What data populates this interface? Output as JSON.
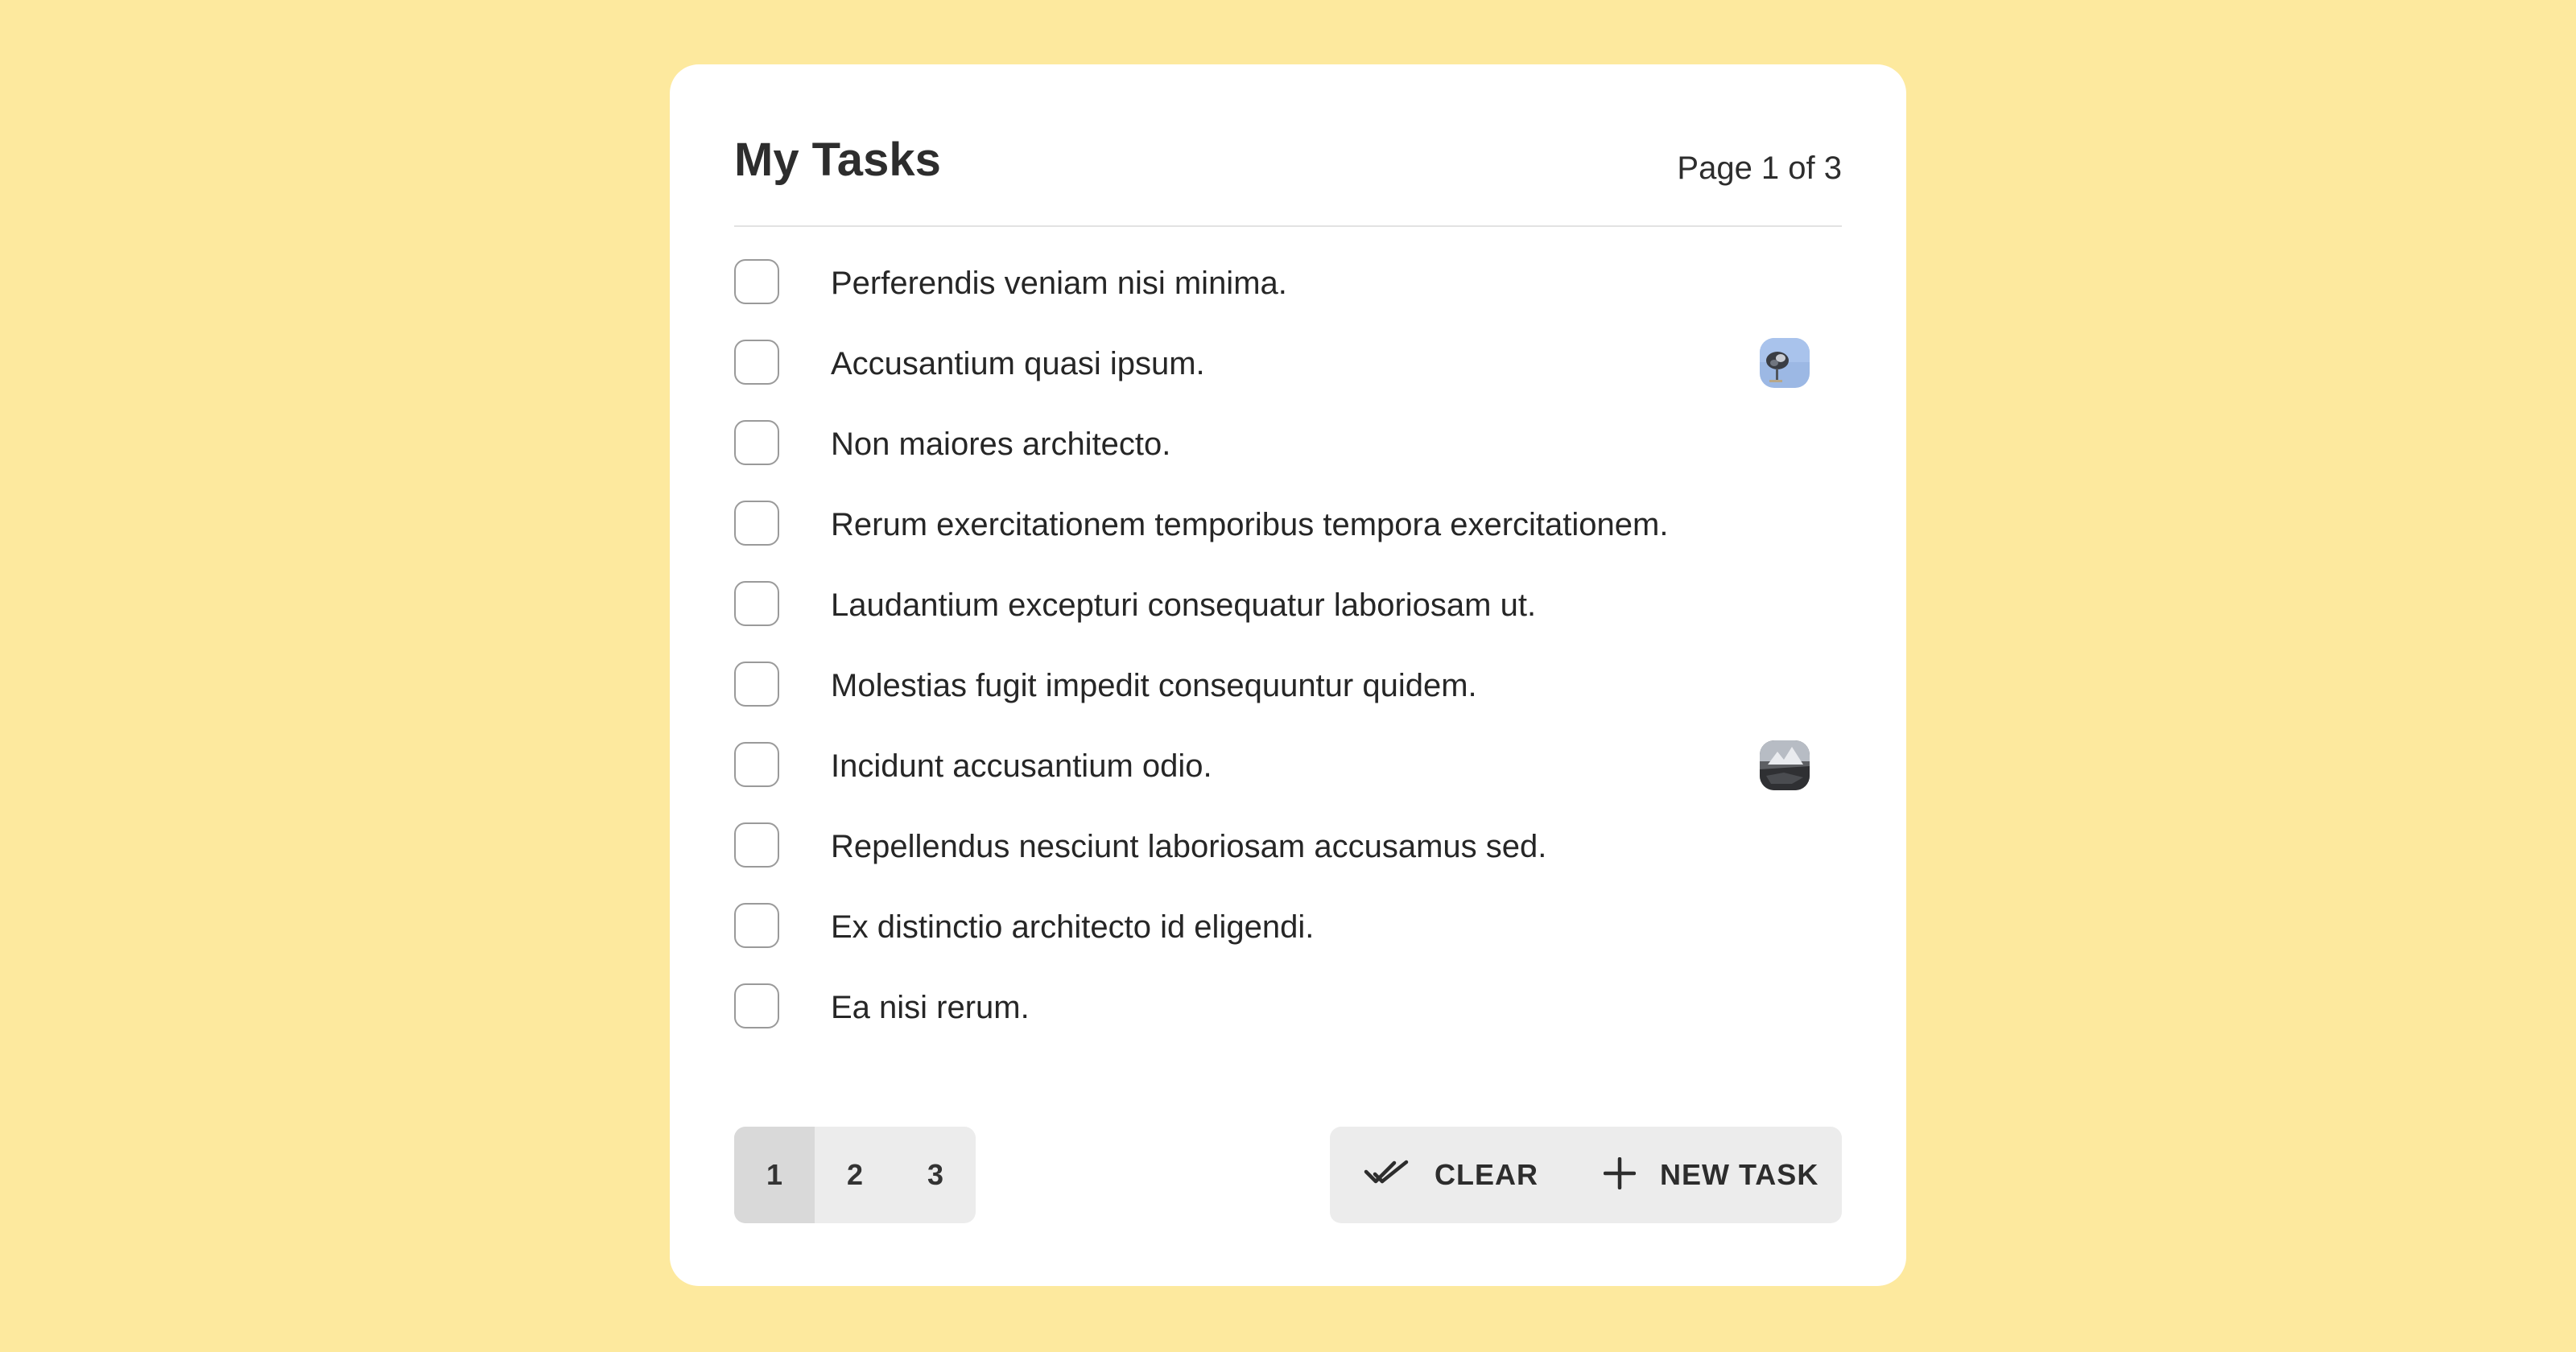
{
  "header": {
    "title": "My Tasks",
    "page_indicator": "Page 1 of 3"
  },
  "tasks": [
    {
      "text": "Perferendis veniam nisi minima.",
      "checked": false,
      "attachment": null
    },
    {
      "text": "Accusantium quasi ipsum.",
      "checked": false,
      "attachment": "photo-thumbnail"
    },
    {
      "text": "Non maiores architecto.",
      "checked": false,
      "attachment": null
    },
    {
      "text": "Rerum exercitationem temporibus tempora exercitationem.",
      "checked": false,
      "attachment": null
    },
    {
      "text": "Laudantium excepturi consequatur laboriosam ut.",
      "checked": false,
      "attachment": null
    },
    {
      "text": "Molestias fugit impedit consequuntur quidem.",
      "checked": false,
      "attachment": null
    },
    {
      "text": "Incidunt accusantium odio.",
      "checked": false,
      "attachment": "photo-thumbnail"
    },
    {
      "text": "Repellendus nesciunt laboriosam accusamus sed.",
      "checked": false,
      "attachment": null
    },
    {
      "text": "Ex distinctio architecto id eligendi.",
      "checked": false,
      "attachment": null
    },
    {
      "text": "Ea nisi rerum.",
      "checked": false,
      "attachment": null
    }
  ],
  "pagination": {
    "pages": [
      "1",
      "2",
      "3"
    ],
    "current": "1"
  },
  "actions": {
    "clear_label": "CLEAR",
    "clear_icon": "double-check-icon",
    "new_task_label": "NEW TASK",
    "new_task_icon": "plus-icon"
  },
  "colors": {
    "background": "#fde99e",
    "card": "#ffffff",
    "button_group": "#ececec",
    "active_page": "#d9d9d9"
  }
}
